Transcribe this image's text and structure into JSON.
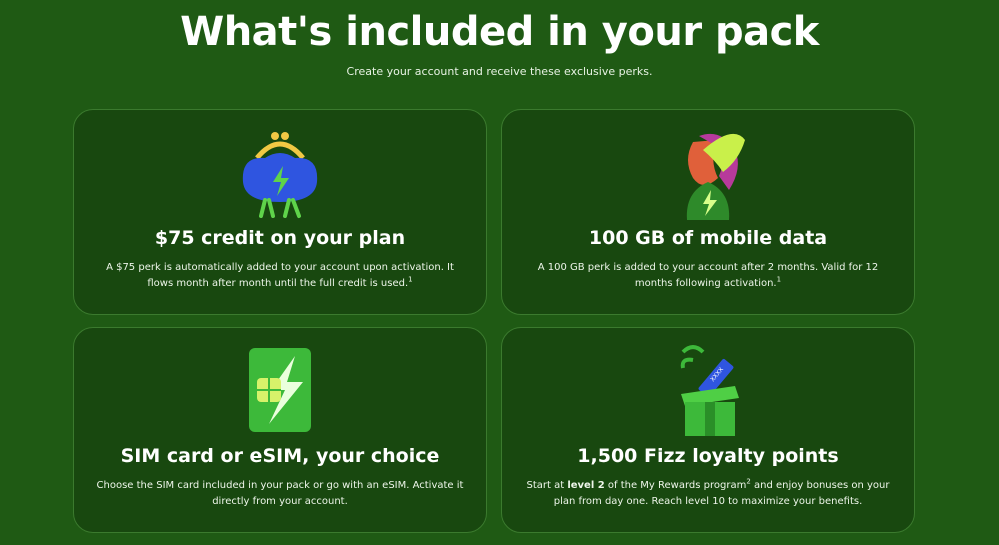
{
  "header": {
    "title": "What's included in your pack",
    "subtitle": "Create your account and receive these exclusive perks."
  },
  "cards": [
    {
      "title": "$75 credit on your plan",
      "desc_main": "A $75 perk is automatically added to your account upon activation. It flows month after month until the full credit is used.",
      "desc_sup": "1",
      "icon": "coin-purse-icon"
    },
    {
      "title": "100 GB of mobile data",
      "desc_main": "A 100 GB perk is added to your account after 2 months. Valid for 12 months following activation.",
      "desc_sup": "1",
      "icon": "data-character-icon"
    },
    {
      "title": "SIM card or eSIM, your choice",
      "desc_main": "Choose the SIM card included in your pack or go with an eSIM. Activate it directly from your account.",
      "icon": "sim-card-icon"
    },
    {
      "title": "1,500 Fizz loyalty points",
      "desc_prefix": "Start at ",
      "desc_bold": "level 2",
      "desc_mid": " of the My Rewards program",
      "desc_sup": "2",
      "desc_suffix": " and enjoy bonuses on your plan from day one. Reach level 10 to maximize your benefits.",
      "icon": "gift-box-icon"
    }
  ],
  "colors": {
    "background": "#1f5a14",
    "card": "#18480f",
    "card_border": "#3b7a2e",
    "accent_green": "#5fd34a",
    "accent_blue": "#2f55e0"
  }
}
